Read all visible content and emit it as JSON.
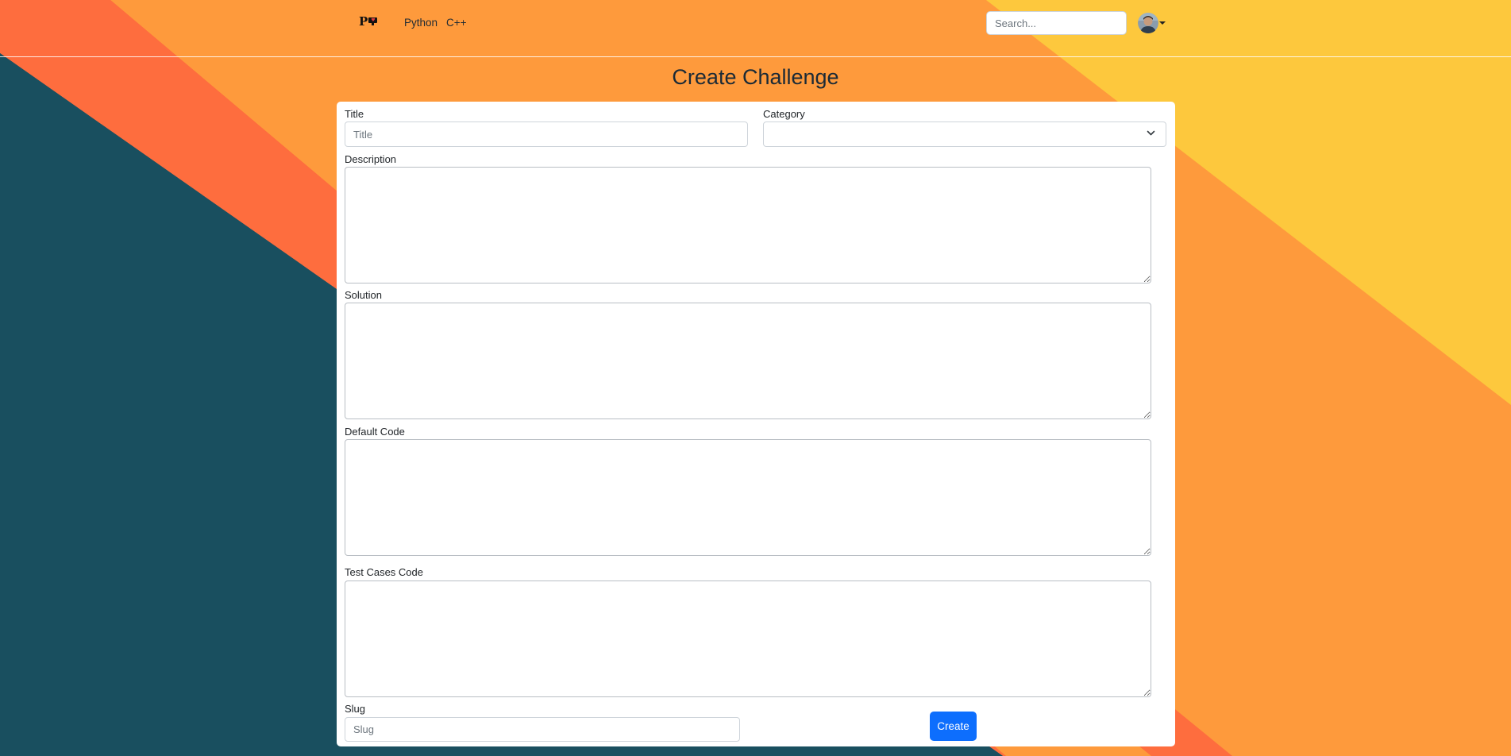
{
  "colors": {
    "navy": "#194f5f",
    "coral": "#fe6d3e",
    "orange": "#fe9a3c",
    "yellow": "#fdc83d",
    "primary": "#0d6efd"
  },
  "navbar": {
    "brand": "P",
    "brand_icon": "monitor-heart-icon",
    "links": [
      "Python",
      "C++"
    ],
    "search_placeholder": "Search...",
    "avatar_icon": "user-avatar",
    "dropdown_icon": "caret-down-icon"
  },
  "page": {
    "title": "Create Challenge"
  },
  "form": {
    "title_label": "Title",
    "title_placeholder": "Title",
    "title_value": "",
    "category_label": "Category",
    "category_value": "",
    "description_label": "Description",
    "solution_label": "Solution",
    "default_code_label": "Default Code",
    "test_cases_label": "Test Cases Code",
    "slug_label": "Slug",
    "slug_placeholder": "Slug",
    "submit_label": "Create"
  }
}
